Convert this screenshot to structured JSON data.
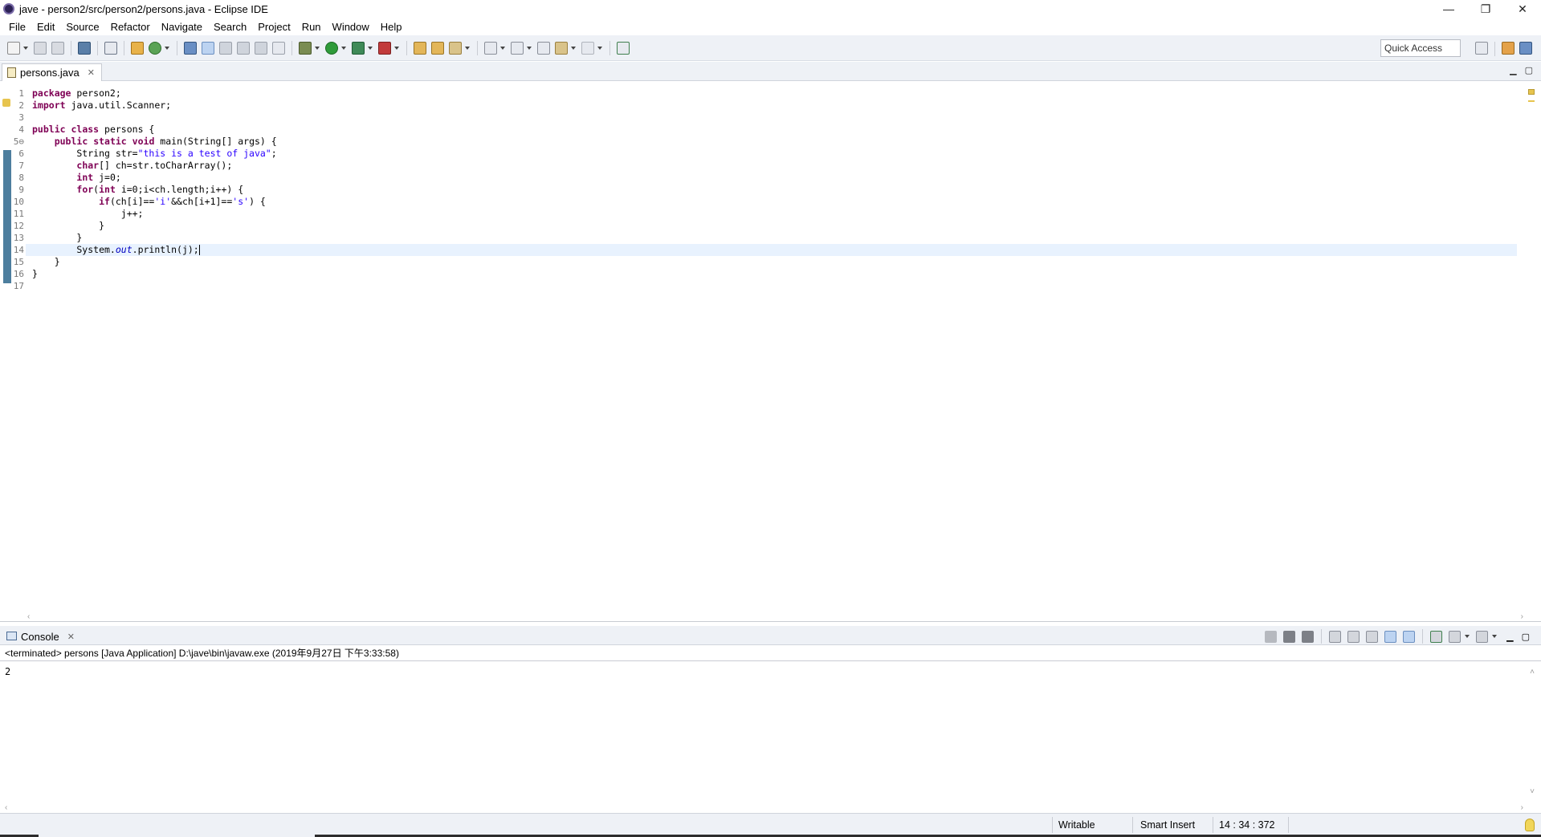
{
  "window": {
    "title": "jave - person2/src/person2/persons.java - Eclipse IDE",
    "minimize": "—",
    "restore": "❐",
    "close": "✕"
  },
  "menu": [
    "File",
    "Edit",
    "Source",
    "Refactor",
    "Navigate",
    "Search",
    "Project",
    "Run",
    "Window",
    "Help"
  ],
  "toolbar": {
    "quick_access_placeholder": "Quick Access"
  },
  "editor": {
    "tab_label": "persons.java",
    "tab_close": "✕",
    "line_numbers": [
      "1",
      "2",
      "3",
      "4",
      "5⊖",
      "6",
      "7",
      "8",
      "9",
      "10",
      "11",
      "12",
      "13",
      "14",
      "15",
      "16",
      "17"
    ],
    "code_lines": [
      "package person2;",
      "import java.util.Scanner;",
      "",
      "public class persons {",
      "    public static void main(String[] args) {",
      "        String str=\"this is a test of java\";",
      "        char[] ch=str.toCharArray();",
      "        int j=0;",
      "        for(int i=0;i<ch.length;i++) {",
      "            if(ch[i]=='i'&&ch[i+1]=='s') {",
      "                j++;",
      "            }",
      "        }",
      "        System.out.println(j);",
      "    }",
      "}",
      ""
    ],
    "current_line": 14
  },
  "console": {
    "tab_label": "Console",
    "tab_close": "✕",
    "status": "<terminated> persons [Java Application] D:\\jave\\bin\\javaw.exe (2019年9月27日 下午3:33:58)",
    "output": "2"
  },
  "statusbar": {
    "writable": "Writable",
    "insert_mode": "Smart Insert",
    "position": "14 : 34 : 372"
  },
  "colors": {
    "keyword": "#7f0055",
    "string": "#2a00ff",
    "field": "#0000c0",
    "toolbar_bg": "#eef1f6",
    "current_line": "#e8f2fe",
    "change_bar": "#4d7e9e"
  }
}
